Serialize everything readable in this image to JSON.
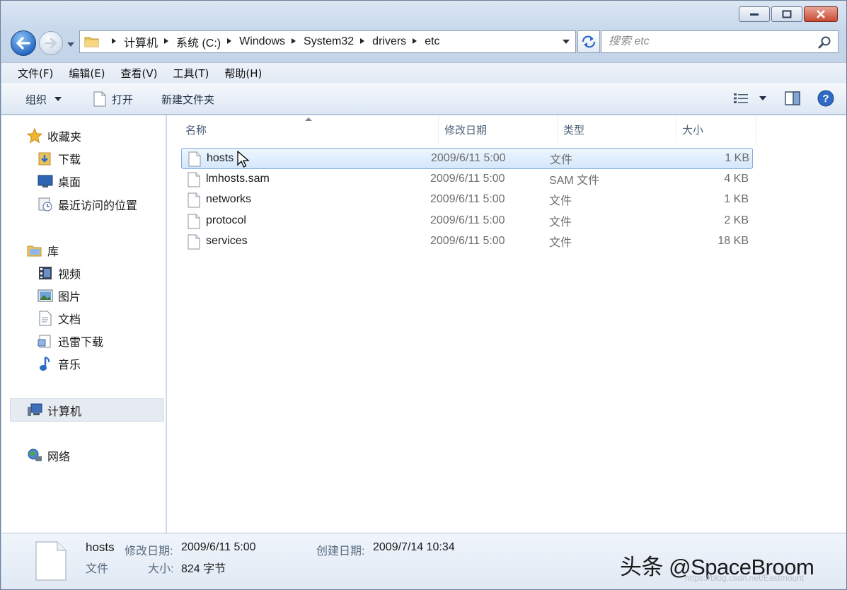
{
  "window": {
    "controls": [
      "minimize",
      "maximize",
      "close"
    ]
  },
  "address": {
    "crumbs": [
      "计算机",
      "系统 (C:)",
      "Windows",
      "System32",
      "drivers",
      "etc"
    ]
  },
  "search": {
    "placeholder": "搜索 etc"
  },
  "menu": [
    "文件(F)",
    "编辑(E)",
    "查看(V)",
    "工具(T)",
    "帮助(H)"
  ],
  "toolbar": {
    "organize": "组织",
    "open": "打开",
    "new_folder": "新建文件夹"
  },
  "sidebar": {
    "favorites": "收藏夹",
    "favorites_items": [
      "下载",
      "桌面",
      "最近访问的位置"
    ],
    "libraries": "库",
    "libraries_items": [
      "视频",
      "图片",
      "文档",
      "迅雷下载",
      "音乐"
    ],
    "computer": "计算机",
    "network": "网络"
  },
  "columns": {
    "name": "名称",
    "modified": "修改日期",
    "type": "类型",
    "size": "大小"
  },
  "files": [
    {
      "name": "hosts",
      "modified": "2009/6/11 5:00",
      "type": "文件",
      "size": "1 KB",
      "selected": true
    },
    {
      "name": "lmhosts.sam",
      "modified": "2009/6/11 5:00",
      "type": "SAM 文件",
      "size": "4 KB",
      "selected": false
    },
    {
      "name": "networks",
      "modified": "2009/6/11 5:00",
      "type": "文件",
      "size": "1 KB",
      "selected": false
    },
    {
      "name": "protocol",
      "modified": "2009/6/11 5:00",
      "type": "文件",
      "size": "2 KB",
      "selected": false
    },
    {
      "name": "services",
      "modified": "2009/6/11 5:00",
      "type": "文件",
      "size": "18 KB",
      "selected": false
    }
  ],
  "details": {
    "name": "hosts",
    "modified_label": "修改日期:",
    "modified_value": "2009/6/11 5:00",
    "created_label": "创建日期:",
    "created_value": "2009/7/14 10:34",
    "type": "文件",
    "size_label": "大小:",
    "size_value": "824 字节"
  },
  "watermark": {
    "brand": "头条 @SpaceBroom",
    "url": "https://blog.csdn.net/Eastmount"
  },
  "colors": {
    "accent": "#2a6cc7",
    "selection_border": "#84acdd",
    "header_text": "#4c607a"
  }
}
